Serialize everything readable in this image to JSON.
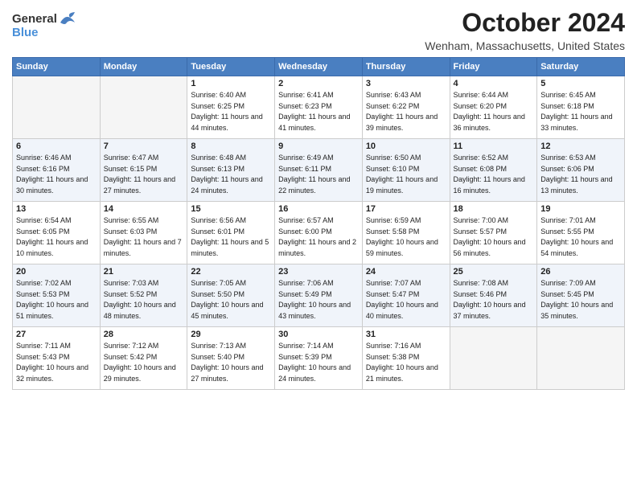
{
  "logo": {
    "general": "General",
    "blue": "Blue"
  },
  "title": "October 2024",
  "location": "Wenham, Massachusetts, United States",
  "headers": [
    "Sunday",
    "Monday",
    "Tuesday",
    "Wednesday",
    "Thursday",
    "Friday",
    "Saturday"
  ],
  "weeks": [
    [
      {
        "day": "",
        "info": ""
      },
      {
        "day": "",
        "info": ""
      },
      {
        "day": "1",
        "info": "Sunrise: 6:40 AM\nSunset: 6:25 PM\nDaylight: 11 hours and 44 minutes."
      },
      {
        "day": "2",
        "info": "Sunrise: 6:41 AM\nSunset: 6:23 PM\nDaylight: 11 hours and 41 minutes."
      },
      {
        "day": "3",
        "info": "Sunrise: 6:43 AM\nSunset: 6:22 PM\nDaylight: 11 hours and 39 minutes."
      },
      {
        "day": "4",
        "info": "Sunrise: 6:44 AM\nSunset: 6:20 PM\nDaylight: 11 hours and 36 minutes."
      },
      {
        "day": "5",
        "info": "Sunrise: 6:45 AM\nSunset: 6:18 PM\nDaylight: 11 hours and 33 minutes."
      }
    ],
    [
      {
        "day": "6",
        "info": "Sunrise: 6:46 AM\nSunset: 6:16 PM\nDaylight: 11 hours and 30 minutes."
      },
      {
        "day": "7",
        "info": "Sunrise: 6:47 AM\nSunset: 6:15 PM\nDaylight: 11 hours and 27 minutes."
      },
      {
        "day": "8",
        "info": "Sunrise: 6:48 AM\nSunset: 6:13 PM\nDaylight: 11 hours and 24 minutes."
      },
      {
        "day": "9",
        "info": "Sunrise: 6:49 AM\nSunset: 6:11 PM\nDaylight: 11 hours and 22 minutes."
      },
      {
        "day": "10",
        "info": "Sunrise: 6:50 AM\nSunset: 6:10 PM\nDaylight: 11 hours and 19 minutes."
      },
      {
        "day": "11",
        "info": "Sunrise: 6:52 AM\nSunset: 6:08 PM\nDaylight: 11 hours and 16 minutes."
      },
      {
        "day": "12",
        "info": "Sunrise: 6:53 AM\nSunset: 6:06 PM\nDaylight: 11 hours and 13 minutes."
      }
    ],
    [
      {
        "day": "13",
        "info": "Sunrise: 6:54 AM\nSunset: 6:05 PM\nDaylight: 11 hours and 10 minutes."
      },
      {
        "day": "14",
        "info": "Sunrise: 6:55 AM\nSunset: 6:03 PM\nDaylight: 11 hours and 7 minutes."
      },
      {
        "day": "15",
        "info": "Sunrise: 6:56 AM\nSunset: 6:01 PM\nDaylight: 11 hours and 5 minutes."
      },
      {
        "day": "16",
        "info": "Sunrise: 6:57 AM\nSunset: 6:00 PM\nDaylight: 11 hours and 2 minutes."
      },
      {
        "day": "17",
        "info": "Sunrise: 6:59 AM\nSunset: 5:58 PM\nDaylight: 10 hours and 59 minutes."
      },
      {
        "day": "18",
        "info": "Sunrise: 7:00 AM\nSunset: 5:57 PM\nDaylight: 10 hours and 56 minutes."
      },
      {
        "day": "19",
        "info": "Sunrise: 7:01 AM\nSunset: 5:55 PM\nDaylight: 10 hours and 54 minutes."
      }
    ],
    [
      {
        "day": "20",
        "info": "Sunrise: 7:02 AM\nSunset: 5:53 PM\nDaylight: 10 hours and 51 minutes."
      },
      {
        "day": "21",
        "info": "Sunrise: 7:03 AM\nSunset: 5:52 PM\nDaylight: 10 hours and 48 minutes."
      },
      {
        "day": "22",
        "info": "Sunrise: 7:05 AM\nSunset: 5:50 PM\nDaylight: 10 hours and 45 minutes."
      },
      {
        "day": "23",
        "info": "Sunrise: 7:06 AM\nSunset: 5:49 PM\nDaylight: 10 hours and 43 minutes."
      },
      {
        "day": "24",
        "info": "Sunrise: 7:07 AM\nSunset: 5:47 PM\nDaylight: 10 hours and 40 minutes."
      },
      {
        "day": "25",
        "info": "Sunrise: 7:08 AM\nSunset: 5:46 PM\nDaylight: 10 hours and 37 minutes."
      },
      {
        "day": "26",
        "info": "Sunrise: 7:09 AM\nSunset: 5:45 PM\nDaylight: 10 hours and 35 minutes."
      }
    ],
    [
      {
        "day": "27",
        "info": "Sunrise: 7:11 AM\nSunset: 5:43 PM\nDaylight: 10 hours and 32 minutes."
      },
      {
        "day": "28",
        "info": "Sunrise: 7:12 AM\nSunset: 5:42 PM\nDaylight: 10 hours and 29 minutes."
      },
      {
        "day": "29",
        "info": "Sunrise: 7:13 AM\nSunset: 5:40 PM\nDaylight: 10 hours and 27 minutes."
      },
      {
        "day": "30",
        "info": "Sunrise: 7:14 AM\nSunset: 5:39 PM\nDaylight: 10 hours and 24 minutes."
      },
      {
        "day": "31",
        "info": "Sunrise: 7:16 AM\nSunset: 5:38 PM\nDaylight: 10 hours and 21 minutes."
      },
      {
        "day": "",
        "info": ""
      },
      {
        "day": "",
        "info": ""
      }
    ]
  ]
}
